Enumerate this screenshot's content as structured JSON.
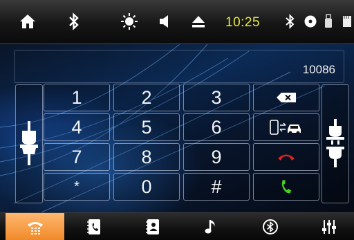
{
  "status_bar": {
    "icons": [
      "home-icon",
      "bluetooth-icon",
      "brightness-icon",
      "volume-icon",
      "eject-icon",
      "bluetooth-status-icon",
      "disc-icon",
      "usb-icon",
      "sd-card-icon"
    ],
    "time": "10:25"
  },
  "dialer": {
    "dialed_number": "10086",
    "keys": [
      "1",
      "2",
      "3",
      "4",
      "5",
      "6",
      "7",
      "8",
      "9",
      "*",
      "0",
      "#"
    ],
    "actions": [
      "backspace-icon",
      "transfer-to-phone-icon",
      "hang-up-icon",
      "call-icon"
    ],
    "colors": {
      "hang_up": "#e52020",
      "call": "#46d11e"
    }
  },
  "bottom_nav": {
    "tabs": [
      "dialpad-icon",
      "call-log-icon",
      "contacts-icon",
      "music-icon",
      "bluetooth-settings-icon",
      "settings-icon"
    ],
    "active": "dialpad-icon",
    "active_color": "#f5a04a"
  }
}
